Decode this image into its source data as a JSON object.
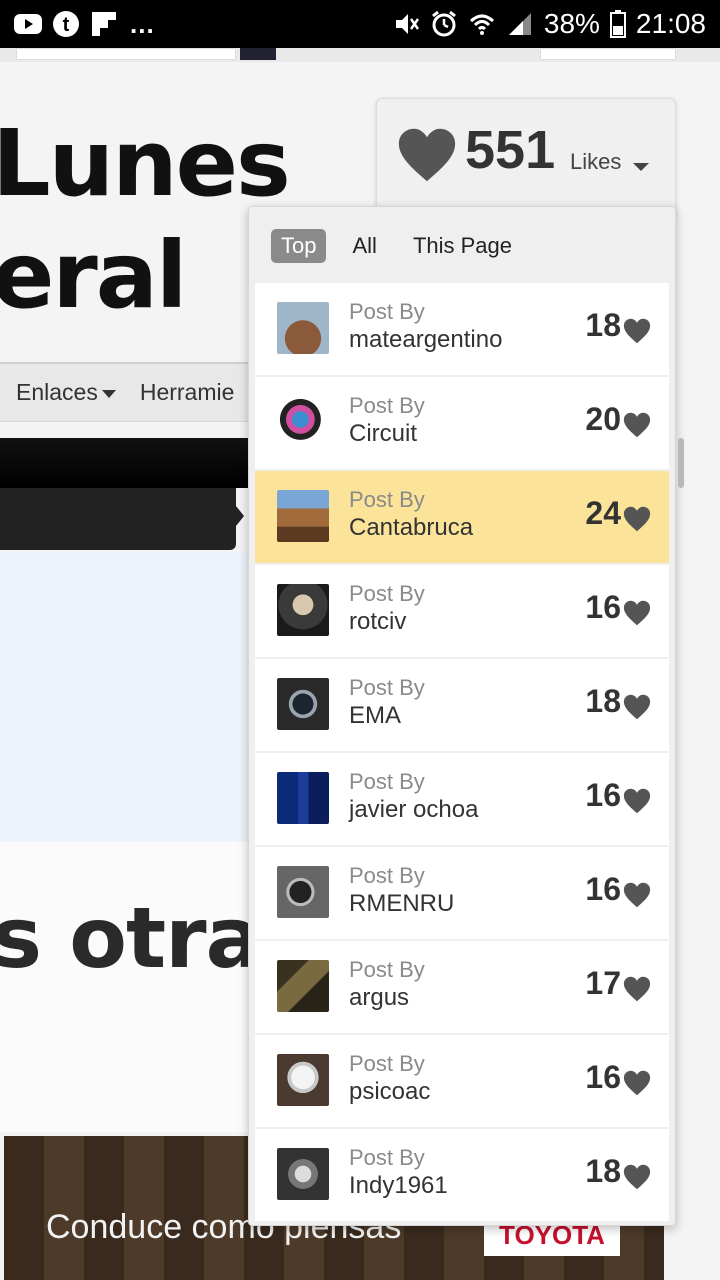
{
  "status_bar": {
    "time": "21:08",
    "battery": "38%",
    "overflow": "...",
    "left_icons": [
      "youtube-icon",
      "tumblr-icon",
      "flipboard-icon"
    ],
    "right_icons": [
      "mute-icon",
      "alarm-icon",
      "wifi-icon",
      "signal-icon",
      "battery-icon"
    ]
  },
  "background_page": {
    "title_line1": "Lunes",
    "title_line2": "eral",
    "nav": {
      "item1": "Enlaces",
      "item2": "Herramie"
    },
    "headline_fragment": "s otra",
    "ad": {
      "text": "Conduce como piensas",
      "logo": "TOYOTA"
    }
  },
  "likes_widget": {
    "count": "551",
    "label": "Likes",
    "tabs": [
      "Top",
      "All",
      "This Page"
    ],
    "active_tab": "Top",
    "post_by_label": "Post By",
    "entries": [
      {
        "user": "mateargentino",
        "likes": "18",
        "highlighted": false
      },
      {
        "user": "Circuit",
        "likes": "20",
        "highlighted": false
      },
      {
        "user": "Cantabruca",
        "likes": "24",
        "highlighted": true
      },
      {
        "user": "rotciv",
        "likes": "16",
        "highlighted": false
      },
      {
        "user": "EMA",
        "likes": "18",
        "highlighted": false
      },
      {
        "user": "javier ochoa",
        "likes": "16",
        "highlighted": false
      },
      {
        "user": "RMENRU",
        "likes": "16",
        "highlighted": false
      },
      {
        "user": "argus",
        "likes": "17",
        "highlighted": false
      },
      {
        "user": "psicoac",
        "likes": "16",
        "highlighted": false
      },
      {
        "user": "Indy1961",
        "likes": "18",
        "highlighted": false
      }
    ]
  },
  "colors": {
    "highlight_row": "#fbe49a",
    "active_tab_bg": "#8a8a8a",
    "heart": "#555555"
  }
}
